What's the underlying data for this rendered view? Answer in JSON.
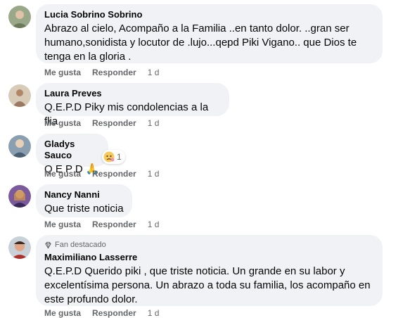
{
  "comments": [
    {
      "author": "Lucia Sobrino Sobrino",
      "lines": [
        "Abrazo al cielo, Acompaño a la Familia ..en tanto dolor. ..gran ser",
        "humano,sonidista y locutor de .lujo...qepd Piki Vigano.. que Dios te",
        "tenga en la gloria ."
      ],
      "like": "Me gusta",
      "reply": "Responder",
      "time": "1 d",
      "avatar_color": "#8a9a7a"
    },
    {
      "author": "Laura Preves",
      "lines": [
        "Q.E.P.D Piky mis condolencias a la flia"
      ],
      "like": "Me gusta",
      "reply": "Responder",
      "time": "1 d",
      "avatar_color": "#c8b49a"
    },
    {
      "author": "Gladys Sauco",
      "lines": [
        "Q E P D 🙏"
      ],
      "like": "Me gusta",
      "reply": "Responder",
      "time": "1 d",
      "avatar_color": "#6f8a9a",
      "reaction": {
        "icon": "sad-face-emoji-icon",
        "count": "1"
      }
    },
    {
      "author": "Nancy Nanni",
      "lines": [
        "Que triste noticia"
      ],
      "like": "Me gusta",
      "reply": "Responder",
      "time": "1 d",
      "avatar_color": "#7a5a9a"
    },
    {
      "author": "Maximiliano Lasserre",
      "badge": "Fan destacado",
      "lines": [
        "Q.E.P.D Querido piki , que triste noticia. Un grande en su labor y",
        "excelentísima persona. Un abrazo a toda su familia, los acompaño en",
        "este profundo dolor."
      ],
      "like": "Me gusta",
      "reply": "Responder",
      "time": "1 d",
      "avatar_color": "#b0605a"
    }
  ]
}
